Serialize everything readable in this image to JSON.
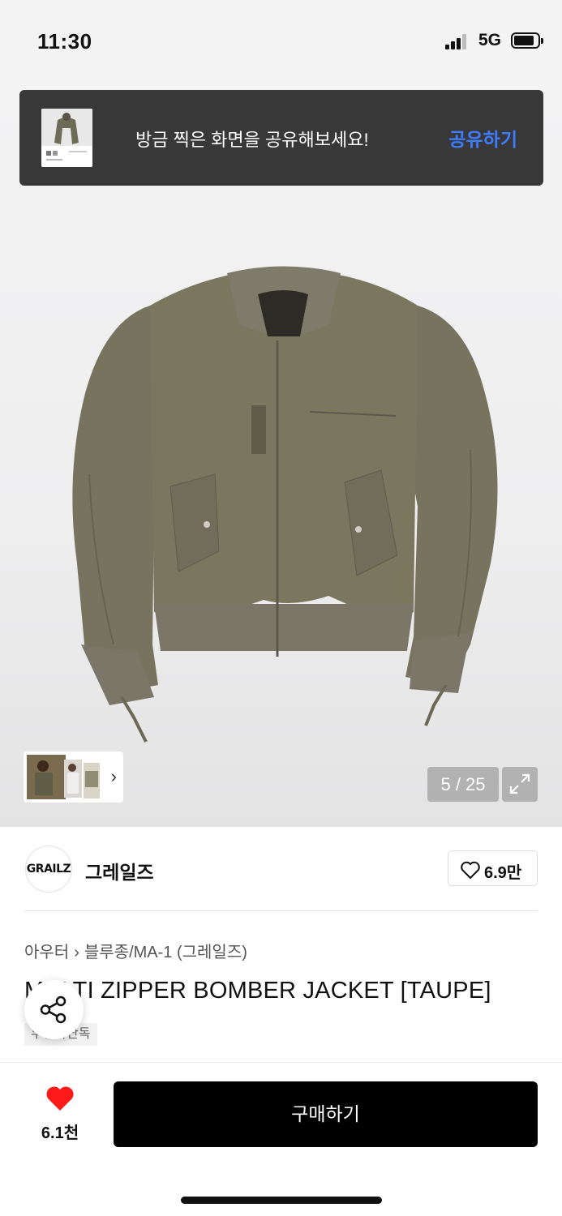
{
  "status_bar": {
    "time": "11:30",
    "network": "5G"
  },
  "toast": {
    "message": "방금 찍은 화면을 공유해보세요!",
    "action_label": "공유하기"
  },
  "gallery": {
    "counter": "5 / 25",
    "current": 5,
    "total": 25
  },
  "brand": {
    "logo_text": "GRAILZ",
    "name": "그레일즈",
    "like_count": "6.9만"
  },
  "breadcrumb": {
    "items": [
      "아우터",
      "블루종/MA-1 (그레일즈)"
    ]
  },
  "product": {
    "title": "MULTI ZIPPER BOMBER JACKET [TAUPE]",
    "badge": "무신사단독"
  },
  "bottom_bar": {
    "favorite_count": "6.1천",
    "buy_label": "구매하기"
  },
  "colors": {
    "accent_blue": "#3d7bff",
    "heart_red": "#ff1a1a",
    "jacket_taupe": "#77735f",
    "toast_bg": "#383838"
  },
  "icons": [
    "signal-icon",
    "battery-icon",
    "chevron-right-icon",
    "expand-icon",
    "heart-outline-icon",
    "share-icon",
    "heart-filled-icon"
  ]
}
